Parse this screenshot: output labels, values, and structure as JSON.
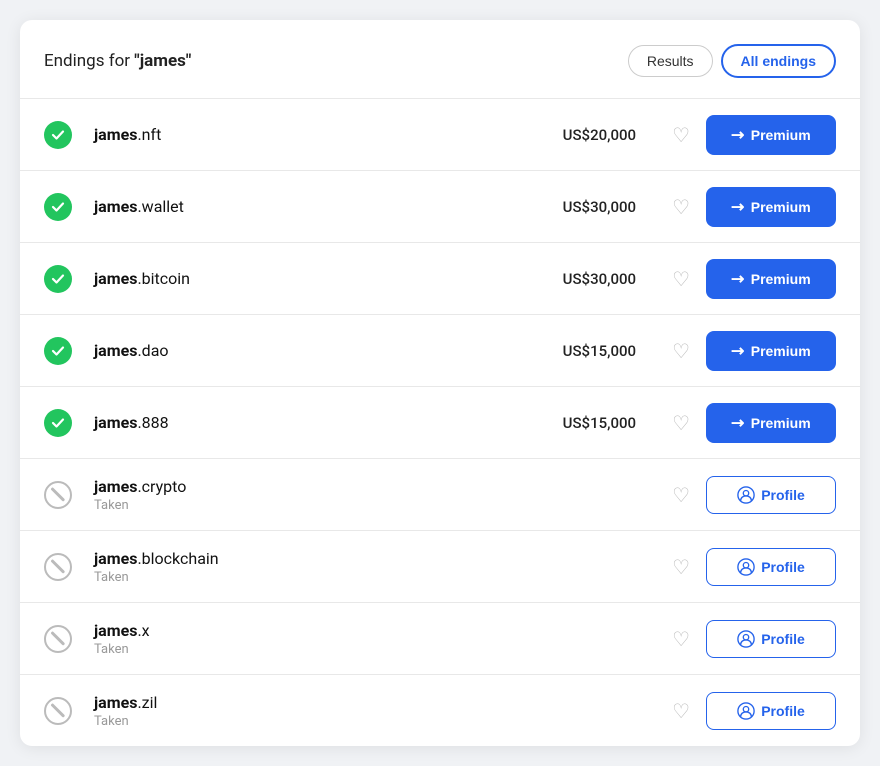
{
  "header": {
    "title_prefix": "Endings for ",
    "search_term": "\"james\"",
    "results_label": "Results",
    "all_endings_label": "All endings"
  },
  "rows": [
    {
      "id": "james-nft",
      "base": "james",
      "ext": ".nft",
      "status": "available",
      "price": "US$20,000",
      "action": "premium"
    },
    {
      "id": "james-wallet",
      "base": "james",
      "ext": ".wallet",
      "status": "available",
      "price": "US$30,000",
      "action": "premium"
    },
    {
      "id": "james-bitcoin",
      "base": "james",
      "ext": ".bitcoin",
      "status": "available",
      "price": "US$30,000",
      "action": "premium"
    },
    {
      "id": "james-dao",
      "base": "james",
      "ext": ".dao",
      "status": "available",
      "price": "US$15,000",
      "action": "premium"
    },
    {
      "id": "james-888",
      "base": "james",
      "ext": ".888",
      "status": "available",
      "price": "US$15,000",
      "action": "premium"
    },
    {
      "id": "james-crypto",
      "base": "james",
      "ext": ".crypto",
      "status": "taken",
      "status_label": "Taken",
      "price": "",
      "action": "profile",
      "action_label": "Profile"
    },
    {
      "id": "james-blockchain",
      "base": "james",
      "ext": ".blockchain",
      "status": "taken",
      "status_label": "Taken",
      "price": "",
      "action": "profile",
      "action_label": "Profile"
    },
    {
      "id": "james-x",
      "base": "james",
      "ext": ".x",
      "status": "taken",
      "status_label": "Taken",
      "price": "",
      "action": "profile",
      "action_label": "Profile"
    },
    {
      "id": "james-zil",
      "base": "james",
      "ext": ".zil",
      "status": "taken",
      "status_label": "Taken",
      "price": "",
      "action": "profile",
      "action_label": "Profile"
    }
  ],
  "premium_label": "Premium",
  "heart_char": "♡"
}
